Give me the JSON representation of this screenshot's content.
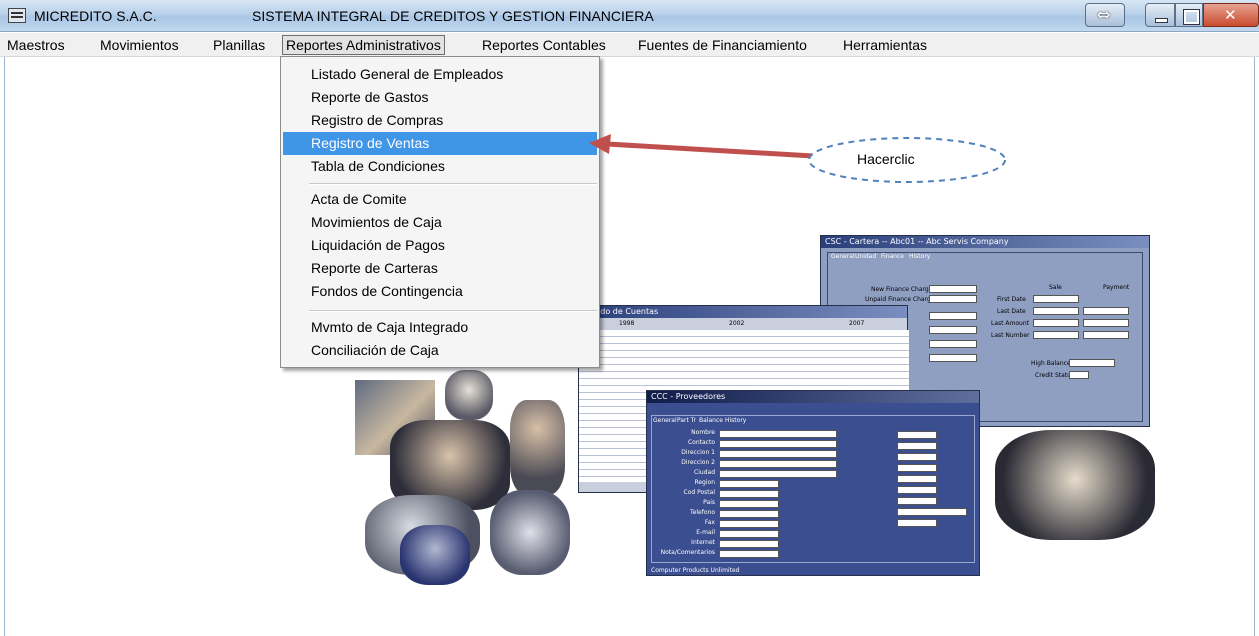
{
  "window": {
    "app_title": "MICREDITO S.A.C.",
    "system_title": "SISTEMA INTEGRAL DE CREDITOS Y GESTION FINANCIERA"
  },
  "menubar": {
    "items": [
      "Maestros",
      "Movimientos",
      "Planillas",
      "Reportes Administrativos",
      "Reportes Contables",
      "Fuentes de Financiamiento",
      "Herramientas"
    ],
    "active_index": 3
  },
  "dropdown": {
    "group1": [
      "Listado General de Empleados",
      "Reporte de Gastos",
      "Registro de Compras",
      "Registro de Ventas",
      "Tabla de Condiciones"
    ],
    "group2": [
      "Acta de Comite",
      "Movimientos de Caja",
      "Liquidación de Pagos",
      "Reporte de Carteras",
      "Fondos de Contingencia"
    ],
    "group3": [
      "Mvmto de Caja Integrado",
      "Conciliación de Caja"
    ],
    "highlighted": "Registro de Ventas"
  },
  "callout": {
    "text": "Hacerclic"
  },
  "collage": {
    "win_back_title": "CSC - Cartera -- Abc01 -- Abc Servis Company",
    "win_back_tabs": [
      "General",
      "Unidad",
      "Finance",
      "History"
    ],
    "win_back_fields": [
      "New Finance Charge",
      "Unpaid Finance Charge"
    ],
    "win_back_cols": [
      "Sale",
      "Payment"
    ],
    "win_back_rows": [
      "First Date",
      "Last Date",
      "Last Amount",
      "Last Number"
    ],
    "win_back_bottom": [
      "High Balance",
      "Credit Status"
    ],
    "win_mid_title": "Estado de Cuentas",
    "win_mid_headers": [
      "1998",
      "2002",
      "2007"
    ],
    "win_front_title": "CCC - Proveedores",
    "win_front_tabs": [
      "General",
      "Part Tr",
      "Balance",
      "History"
    ],
    "win_front_labels": [
      "Nombre",
      "Contacto",
      "Direccion 1",
      "Direccion 2",
      "Ciudad",
      "Region",
      "Cod Postal",
      "Pais",
      "Telefono",
      "Fax",
      "E-mail",
      "Internet",
      "Nota/Comentarios"
    ],
    "win_front_status": "Computer Products Unlimited"
  },
  "colors": {
    "highlight": "#3f95e6",
    "arrow": "#c0504d",
    "callout_border": "#4f81bd"
  }
}
